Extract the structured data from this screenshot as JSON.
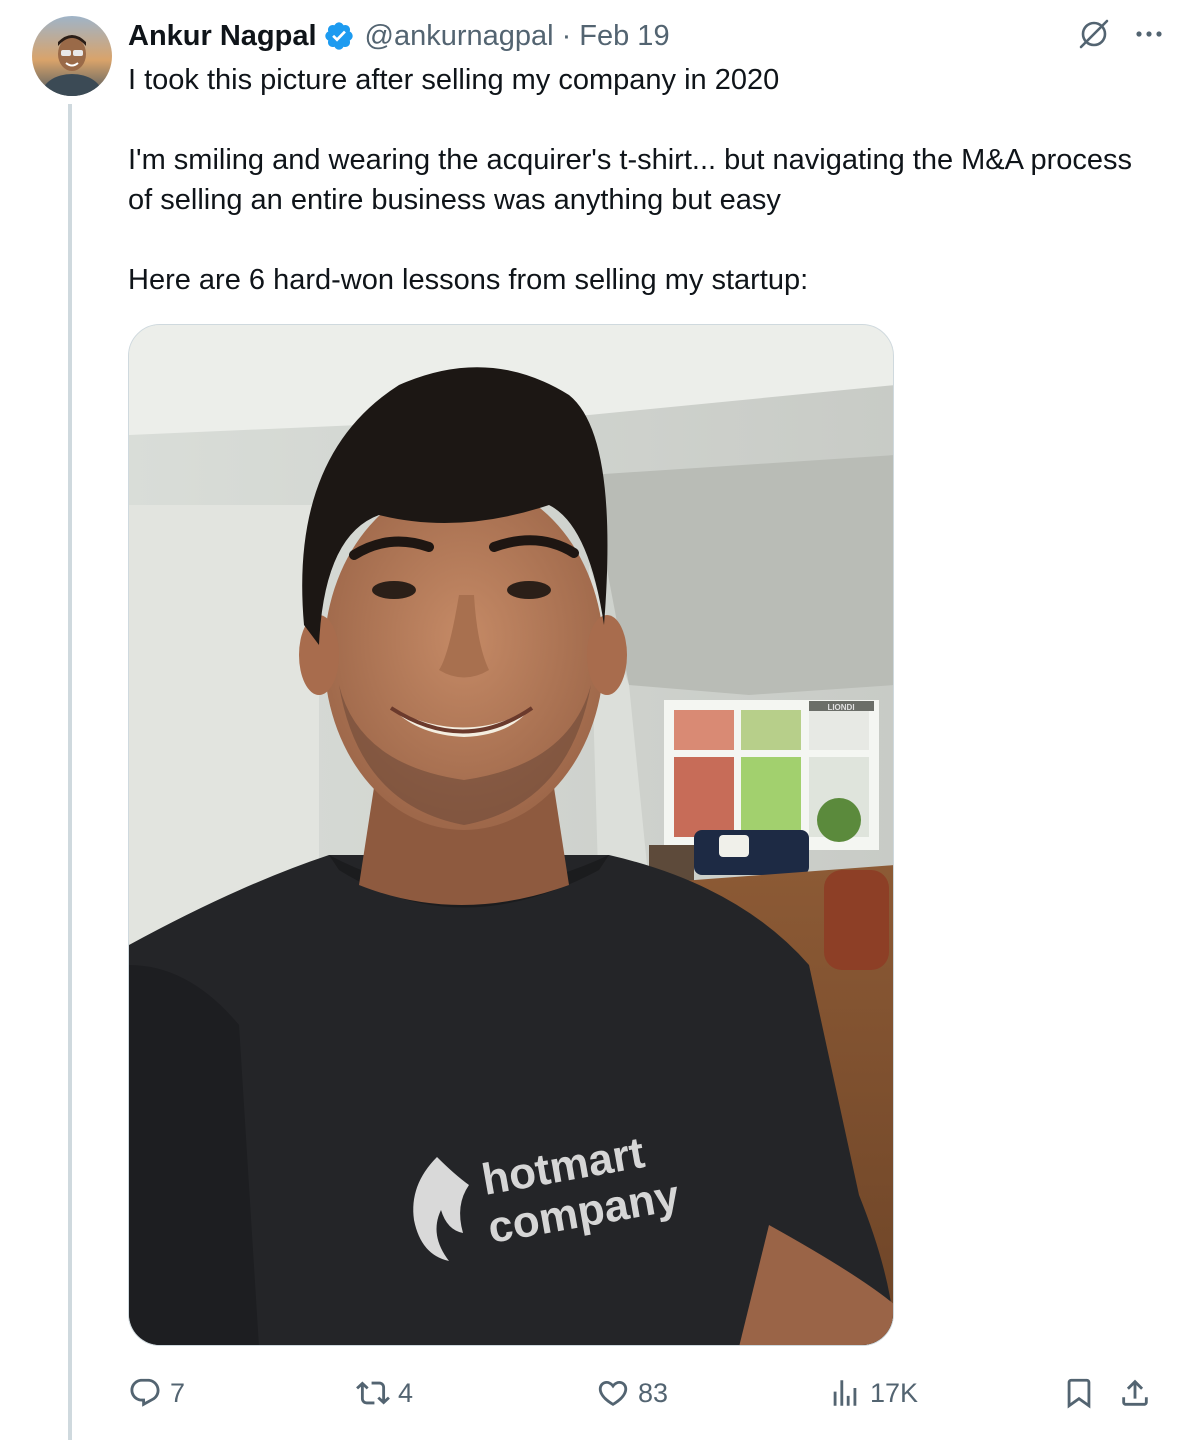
{
  "author": {
    "name": "Ankur Nagpal",
    "handle": "@ankurnagpal",
    "separator": "·",
    "date": "Feb 19"
  },
  "tweet": {
    "paragraphs": [
      "I took this picture after selling my company in 2020",
      "I'm smiling and wearing the acquirer's t-shirt... but navigating the M&A process of selling an entire business was anything but easy",
      "Here are 6 hard-won lessons from selling my startup:"
    ]
  },
  "media": {
    "shirt_logo_line1": "hotmart",
    "shirt_logo_line2": "company",
    "store_sign": "LIONDI"
  },
  "actions": {
    "replies": "7",
    "retweets": "4",
    "likes": "83",
    "views": "17K"
  },
  "icons": {
    "verified": "verified-badge-icon",
    "grok": "grok-icon",
    "more": "more-icon",
    "reply": "reply-icon",
    "retweet": "retweet-icon",
    "like": "like-icon",
    "views": "views-icon",
    "bookmark": "bookmark-icon",
    "share": "share-icon"
  },
  "colors": {
    "text": "#0f1419",
    "secondary": "#536471",
    "verified": "#1d9bf0",
    "thread_line": "#cfd9de"
  }
}
